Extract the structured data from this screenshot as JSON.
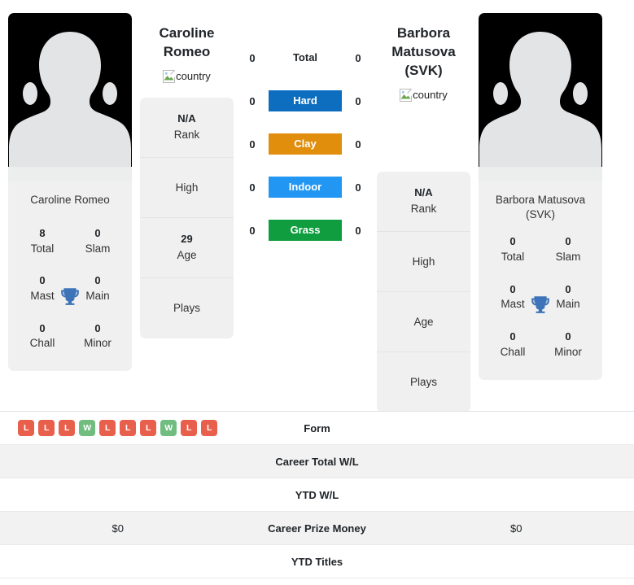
{
  "players": {
    "left": {
      "name": "Caroline Romeo",
      "name_lines": [
        "Caroline",
        "Romeo"
      ],
      "flag_alt": "country",
      "card_name": "Caroline Romeo",
      "titles": [
        {
          "value": "8",
          "label": "Total"
        },
        {
          "value": "0",
          "label": "Slam"
        },
        {
          "value": "0",
          "label": "Mast"
        },
        {
          "value": "0",
          "label": "Main"
        },
        {
          "value": "0",
          "label": "Chall"
        },
        {
          "value": "0",
          "label": "Minor"
        }
      ],
      "info": [
        {
          "value": "N/A",
          "label": "Rank"
        },
        {
          "value": "",
          "label": "High"
        },
        {
          "value": "29",
          "label": "Age"
        },
        {
          "value": "",
          "label": "Plays"
        }
      ],
      "surface_values": [
        "0",
        "0",
        "0",
        "0",
        "0"
      ],
      "form": [
        "L",
        "L",
        "L",
        "W",
        "L",
        "L",
        "L",
        "W",
        "L",
        "L"
      ],
      "career_total_wl": "",
      "ytd_wl": "",
      "career_prize_money": "$0",
      "ytd_titles": ""
    },
    "right": {
      "name": "Barbora Matusova (SVK)",
      "name_lines": [
        "Barbora",
        "Matusova (SVK)"
      ],
      "flag_alt": "country",
      "card_name": "Barbora Matusova (SVK)",
      "titles": [
        {
          "value": "0",
          "label": "Total"
        },
        {
          "value": "0",
          "label": "Slam"
        },
        {
          "value": "0",
          "label": "Mast"
        },
        {
          "value": "0",
          "label": "Main"
        },
        {
          "value": "0",
          "label": "Chall"
        },
        {
          "value": "0",
          "label": "Minor"
        }
      ],
      "info": [
        {
          "value": "N/A",
          "label": "Rank"
        },
        {
          "value": "",
          "label": "High"
        },
        {
          "value": "",
          "label": "Age"
        },
        {
          "value": "",
          "label": "Plays"
        }
      ],
      "surface_values": [
        "0",
        "0",
        "0",
        "0",
        "0"
      ],
      "form": [],
      "career_total_wl": "",
      "ytd_wl": "",
      "career_prize_money": "$0",
      "ytd_titles": ""
    }
  },
  "surfaces": [
    {
      "label": "Total",
      "color": "transparent",
      "text_color": "#212529"
    },
    {
      "label": "Hard",
      "color": "#0d6ec0",
      "text_color": "#ffffff"
    },
    {
      "label": "Clay",
      "color": "#e08e0b",
      "text_color": "#ffffff"
    },
    {
      "label": "Indoor",
      "color": "#2196f3",
      "text_color": "#ffffff"
    },
    {
      "label": "Grass",
      "color": "#0f9d3f",
      "text_color": "#ffffff"
    }
  ],
  "stats_rows": [
    {
      "label": "Form",
      "key": "form",
      "kind": "form"
    },
    {
      "label": "Career Total W/L",
      "key": "career_total_wl",
      "kind": "text"
    },
    {
      "label": "YTD W/L",
      "key": "ytd_wl",
      "kind": "text"
    },
    {
      "label": "Career Prize Money",
      "key": "career_prize_money",
      "kind": "text"
    },
    {
      "label": "YTD Titles",
      "key": "ytd_titles",
      "kind": "text"
    }
  ],
  "colors": {
    "win_badge": "#71bd7f",
    "loss_badge": "#e8604c",
    "trophy": "#3d73b8",
    "card_bg": "#f0f0f0",
    "stripe_bg": "#f2f2f2"
  },
  "icons": {
    "trophy": "trophy-icon",
    "broken_image": "broken-image-icon",
    "avatar": "player-avatar-placeholder"
  }
}
